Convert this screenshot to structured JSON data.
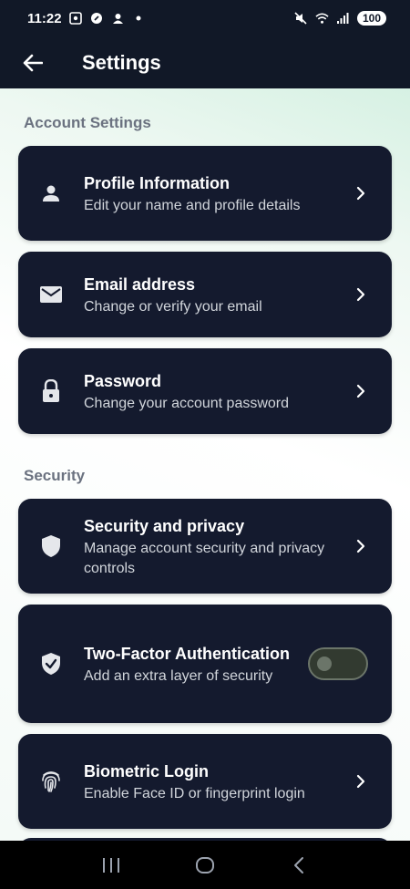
{
  "status_bar": {
    "time": "11:22",
    "battery": "100",
    "icons": [
      "screenshot-icon",
      "app-icon",
      "face-icon",
      "dot-icon",
      "mute-icon",
      "wifi-icon",
      "signal-icon"
    ]
  },
  "app_bar": {
    "title": "Settings",
    "back_icon": "arrow-left-icon"
  },
  "sections": {
    "account": {
      "title": "Account Settings",
      "items": [
        {
          "title": "Profile Information",
          "subtitle": "Edit your name and profile details",
          "icon": "person-icon"
        },
        {
          "title": "Email address",
          "subtitle": "Change or verify your email",
          "icon": "mail-icon"
        },
        {
          "title": "Password",
          "subtitle": "Change your account password",
          "icon": "lock-icon"
        }
      ]
    },
    "security": {
      "title": "Security",
      "items": [
        {
          "title": "Security and privacy",
          "subtitle": "Manage account security and privacy controls",
          "icon": "shield-icon"
        },
        {
          "title": "Two-Factor Authentication",
          "subtitle": "Add an extra layer of security",
          "icon": "shield-check-icon",
          "toggle_on": false
        },
        {
          "title": "Biometric Login",
          "subtitle": "Enable Face ID or fingerprint login",
          "icon": "fingerprint-icon"
        }
      ]
    }
  },
  "nav_bar": {
    "buttons": [
      "recents-icon",
      "home-icon",
      "back-icon"
    ]
  },
  "colors": {
    "header_bg": "#111827",
    "card_bg": "#141a2e",
    "section_title": "#6b7280"
  }
}
